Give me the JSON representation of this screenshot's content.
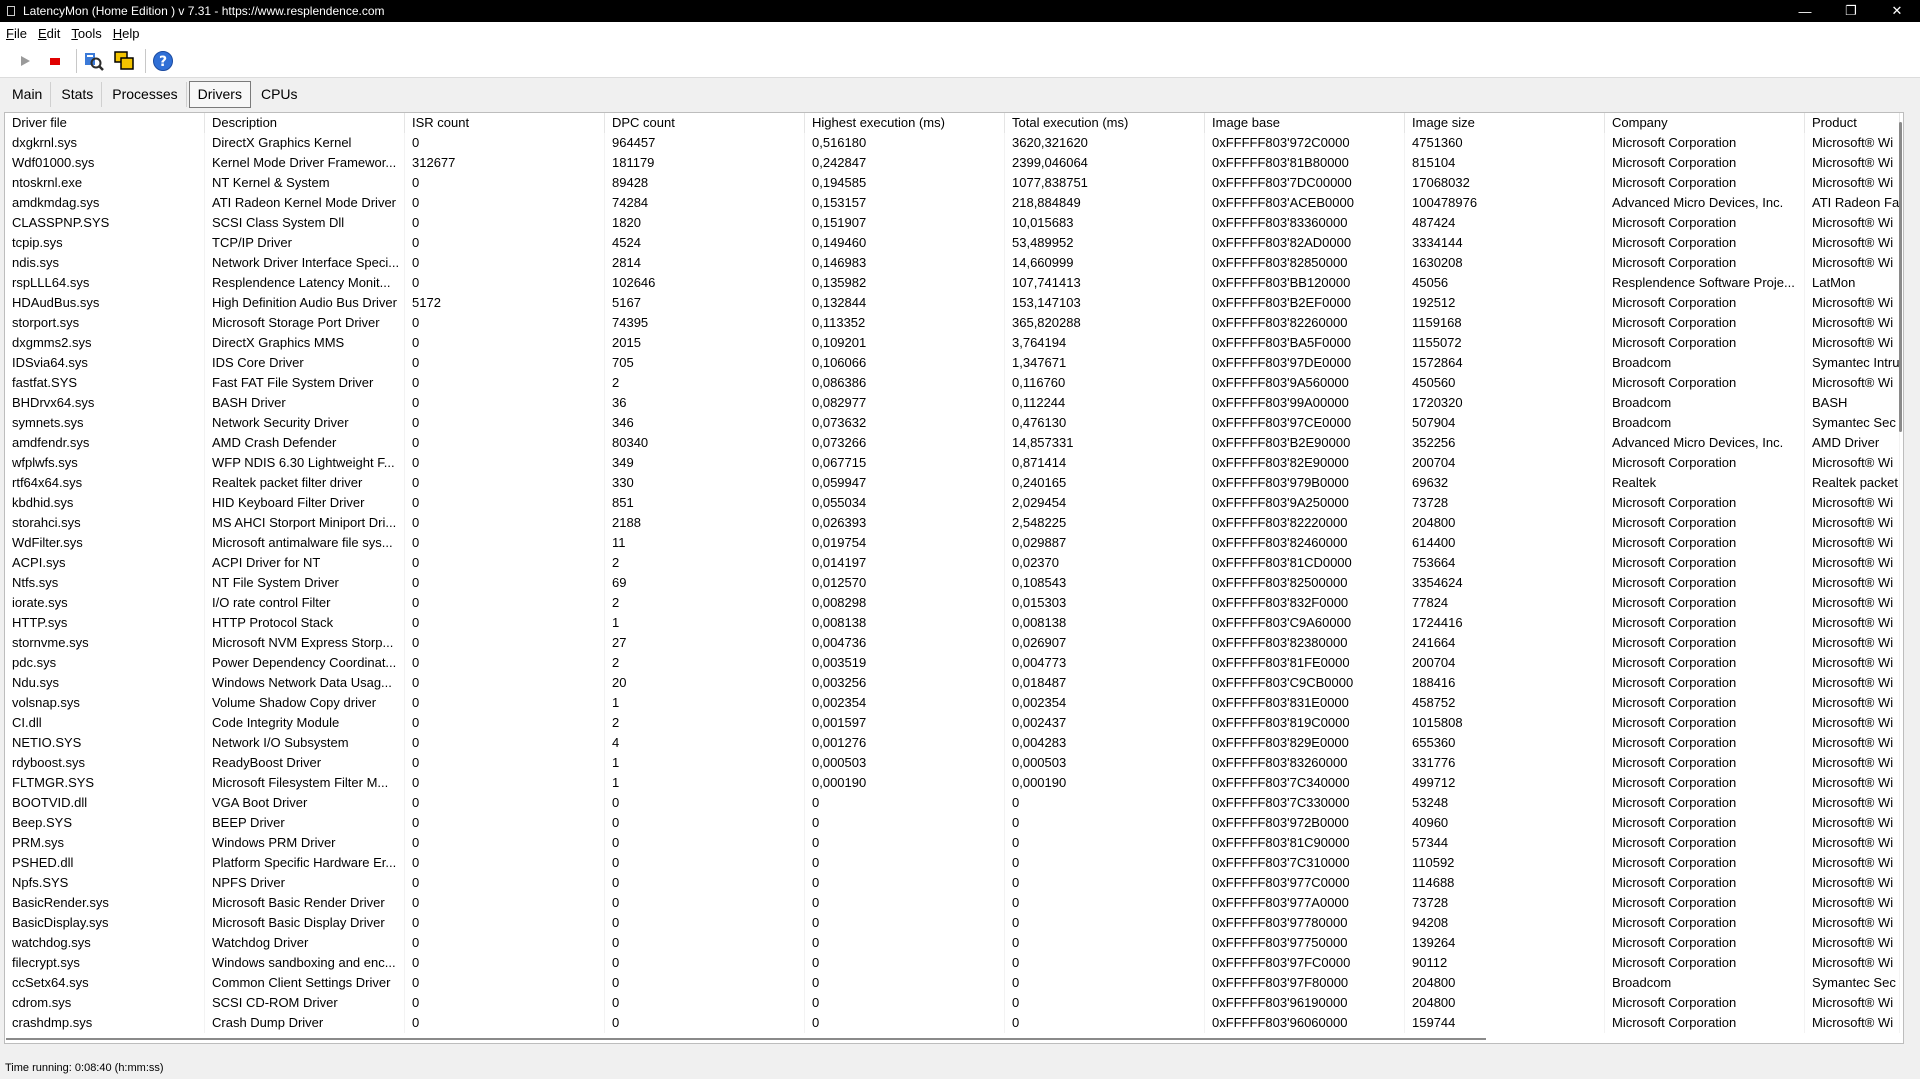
{
  "window": {
    "title": "LatencyMon  (Home Edition )  v 7.31  -  https://www.resplendence.com",
    "minimize_glyph": "—",
    "restore_glyph": "❐",
    "close_glyph": "✕"
  },
  "menu": [
    "File",
    "Edit",
    "Tools",
    "Help"
  ],
  "toolbar": {
    "icons": [
      "play-icon",
      "stop-icon",
      "search-drivers-icon",
      "windows-icon",
      "help-icon"
    ]
  },
  "tabs": [
    {
      "label": "Main",
      "active": false
    },
    {
      "label": "Stats",
      "active": false
    },
    {
      "label": "Processes",
      "active": false
    },
    {
      "label": "Drivers",
      "active": true
    },
    {
      "label": "CPUs",
      "active": false
    }
  ],
  "table": {
    "columns": [
      "Driver file",
      "Description",
      "ISR count",
      "DPC count",
      "Highest execution (ms)",
      "Total execution (ms)",
      "Image base",
      "Image size",
      "Company",
      "Product"
    ],
    "rows": [
      [
        "dxgkrnl.sys",
        "DirectX Graphics Kernel",
        "0",
        "964457",
        "0,516180",
        "3620,321620",
        "0xFFFFF803'972C0000",
        "4751360",
        "Microsoft Corporation",
        "Microsoft® Wi"
      ],
      [
        "Wdf01000.sys",
        "Kernel Mode Driver Framewor...",
        "312677",
        "181179",
        "0,242847",
        "2399,046064",
        "0xFFFFF803'81B80000",
        "815104",
        "Microsoft Corporation",
        "Microsoft® Wi"
      ],
      [
        "ntoskrnl.exe",
        "NT Kernel & System",
        "0",
        "89428",
        "0,194585",
        "1077,838751",
        "0xFFFFF803'7DC00000",
        "17068032",
        "Microsoft Corporation",
        "Microsoft® Wi"
      ],
      [
        "amdkmdag.sys",
        "ATI Radeon Kernel Mode Driver",
        "0",
        "74284",
        "0,153157",
        "218,884849",
        "0xFFFFF803'ACEB0000",
        "100478976",
        "Advanced Micro Devices, Inc.",
        "ATI Radeon Fa"
      ],
      [
        "CLASSPNP.SYS",
        "SCSI Class System Dll",
        "0",
        "1820",
        "0,151907",
        "10,015683",
        "0xFFFFF803'83360000",
        "487424",
        "Microsoft Corporation",
        "Microsoft® Wi"
      ],
      [
        "tcpip.sys",
        "TCP/IP Driver",
        "0",
        "4524",
        "0,149460",
        "53,489952",
        "0xFFFFF803'82AD0000",
        "3334144",
        "Microsoft Corporation",
        "Microsoft® Wi"
      ],
      [
        "ndis.sys",
        "Network Driver Interface Speci...",
        "0",
        "2814",
        "0,146983",
        "14,660999",
        "0xFFFFF803'82850000",
        "1630208",
        "Microsoft Corporation",
        "Microsoft® Wi"
      ],
      [
        "rspLLL64.sys",
        "Resplendence Latency Monit...",
        "0",
        "102646",
        "0,135982",
        "107,741413",
        "0xFFFFF803'BB120000",
        "45056",
        "Resplendence Software Proje...",
        "LatMon"
      ],
      [
        "HDAudBus.sys",
        "High Definition Audio Bus Driver",
        "5172",
        "5167",
        "0,132844",
        "153,147103",
        "0xFFFFF803'B2EF0000",
        "192512",
        "Microsoft Corporation",
        "Microsoft® Wi"
      ],
      [
        "storport.sys",
        "Microsoft Storage Port Driver",
        "0",
        "74395",
        "0,113352",
        "365,820288",
        "0xFFFFF803'82260000",
        "1159168",
        "Microsoft Corporation",
        "Microsoft® Wi"
      ],
      [
        "dxgmms2.sys",
        "DirectX Graphics MMS",
        "0",
        "2015",
        "0,109201",
        "3,764194",
        "0xFFFFF803'BA5F0000",
        "1155072",
        "Microsoft Corporation",
        "Microsoft® Wi"
      ],
      [
        "IDSvia64.sys",
        "IDS Core Driver",
        "0",
        "705",
        "0,106066",
        "1,347671",
        "0xFFFFF803'97DE0000",
        "1572864",
        "Broadcom",
        "Symantec Intru"
      ],
      [
        "fastfat.SYS",
        "Fast FAT File System Driver",
        "0",
        "2",
        "0,086386",
        "0,116760",
        "0xFFFFF803'9A560000",
        "450560",
        "Microsoft Corporation",
        "Microsoft® Wi"
      ],
      [
        "BHDrvx64.sys",
        "BASH Driver",
        "0",
        "36",
        "0,082977",
        "0,112244",
        "0xFFFFF803'99A00000",
        "1720320",
        "Broadcom",
        "BASH"
      ],
      [
        "symnets.sys",
        "Network Security Driver",
        "0",
        "346",
        "0,073632",
        "0,476130",
        "0xFFFFF803'97CE0000",
        "507904",
        "Broadcom",
        "Symantec Sec"
      ],
      [
        "amdfendr.sys",
        "AMD Crash Defender",
        "0",
        "80340",
        "0,073266",
        "14,857331",
        "0xFFFFF803'B2E90000",
        "352256",
        "Advanced Micro Devices, Inc.",
        "AMD Driver"
      ],
      [
        "wfplwfs.sys",
        "WFP NDIS 6.30 Lightweight F...",
        "0",
        "349",
        "0,067715",
        "0,871414",
        "0xFFFFF803'82E90000",
        "200704",
        "Microsoft Corporation",
        "Microsoft® Wi"
      ],
      [
        "rtf64x64.sys",
        "Realtek packet filter driver",
        "0",
        "330",
        "0,059947",
        "0,240165",
        "0xFFFFF803'979B0000",
        "69632",
        "Realtek",
        "Realtek packet"
      ],
      [
        "kbdhid.sys",
        "HID Keyboard Filter Driver",
        "0",
        "851",
        "0,055034",
        "2,029454",
        "0xFFFFF803'9A250000",
        "73728",
        "Microsoft Corporation",
        "Microsoft® Wi"
      ],
      [
        "storahci.sys",
        "MS AHCI Storport Miniport Dri...",
        "0",
        "2188",
        "0,026393",
        "2,548225",
        "0xFFFFF803'82220000",
        "204800",
        "Microsoft Corporation",
        "Microsoft® Wi"
      ],
      [
        "WdFilter.sys",
        "Microsoft antimalware file sys...",
        "0",
        "11",
        "0,019754",
        "0,029887",
        "0xFFFFF803'82460000",
        "614400",
        "Microsoft Corporation",
        "Microsoft® Wi"
      ],
      [
        "ACPI.sys",
        "ACPI Driver for NT",
        "0",
        "2",
        "0,014197",
        "0,02370",
        "0xFFFFF803'81CD0000",
        "753664",
        "Microsoft Corporation",
        "Microsoft® Wi"
      ],
      [
        "Ntfs.sys",
        "NT File System Driver",
        "0",
        "69",
        "0,012570",
        "0,108543",
        "0xFFFFF803'82500000",
        "3354624",
        "Microsoft Corporation",
        "Microsoft® Wi"
      ],
      [
        "iorate.sys",
        "I/O rate control Filter",
        "0",
        "2",
        "0,008298",
        "0,015303",
        "0xFFFFF803'832F0000",
        "77824",
        "Microsoft Corporation",
        "Microsoft® Wi"
      ],
      [
        "HTTP.sys",
        "HTTP Protocol Stack",
        "0",
        "1",
        "0,008138",
        "0,008138",
        "0xFFFFF803'C9A60000",
        "1724416",
        "Microsoft Corporation",
        "Microsoft® Wi"
      ],
      [
        "stornvme.sys",
        "Microsoft NVM Express Storp...",
        "0",
        "27",
        "0,004736",
        "0,026907",
        "0xFFFFF803'82380000",
        "241664",
        "Microsoft Corporation",
        "Microsoft® Wi"
      ],
      [
        "pdc.sys",
        "Power Dependency Coordinat...",
        "0",
        "2",
        "0,003519",
        "0,004773",
        "0xFFFFF803'81FE0000",
        "200704",
        "Microsoft Corporation",
        "Microsoft® Wi"
      ],
      [
        "Ndu.sys",
        "Windows Network Data Usag...",
        "0",
        "20",
        "0,003256",
        "0,018487",
        "0xFFFFF803'C9CB0000",
        "188416",
        "Microsoft Corporation",
        "Microsoft® Wi"
      ],
      [
        "volsnap.sys",
        "Volume Shadow Copy driver",
        "0",
        "1",
        "0,002354",
        "0,002354",
        "0xFFFFF803'831E0000",
        "458752",
        "Microsoft Corporation",
        "Microsoft® Wi"
      ],
      [
        "CI.dll",
        "Code Integrity Module",
        "0",
        "2",
        "0,001597",
        "0,002437",
        "0xFFFFF803'819C0000",
        "1015808",
        "Microsoft Corporation",
        "Microsoft® Wi"
      ],
      [
        "NETIO.SYS",
        "Network I/O Subsystem",
        "0",
        "4",
        "0,001276",
        "0,004283",
        "0xFFFFF803'829E0000",
        "655360",
        "Microsoft Corporation",
        "Microsoft® Wi"
      ],
      [
        "rdyboost.sys",
        "ReadyBoost Driver",
        "0",
        "1",
        "0,000503",
        "0,000503",
        "0xFFFFF803'83260000",
        "331776",
        "Microsoft Corporation",
        "Microsoft® Wi"
      ],
      [
        "FLTMGR.SYS",
        "Microsoft Filesystem Filter M...",
        "0",
        "1",
        "0,000190",
        "0,000190",
        "0xFFFFF803'7C340000",
        "499712",
        "Microsoft Corporation",
        "Microsoft® Wi"
      ],
      [
        "BOOTVID.dll",
        "VGA Boot Driver",
        "0",
        "0",
        "0",
        "0",
        "0xFFFFF803'7C330000",
        "53248",
        "Microsoft Corporation",
        "Microsoft® Wi"
      ],
      [
        "Beep.SYS",
        "BEEP Driver",
        "0",
        "0",
        "0",
        "0",
        "0xFFFFF803'972B0000",
        "40960",
        "Microsoft Corporation",
        "Microsoft® Wi"
      ],
      [
        "PRM.sys",
        "Windows PRM Driver",
        "0",
        "0",
        "0",
        "0",
        "0xFFFFF803'81C90000",
        "57344",
        "Microsoft Corporation",
        "Microsoft® Wi"
      ],
      [
        "PSHED.dll",
        "Platform Specific Hardware Er...",
        "0",
        "0",
        "0",
        "0",
        "0xFFFFF803'7C310000",
        "110592",
        "Microsoft Corporation",
        "Microsoft® Wi"
      ],
      [
        "Npfs.SYS",
        "NPFS Driver",
        "0",
        "0",
        "0",
        "0",
        "0xFFFFF803'977C0000",
        "114688",
        "Microsoft Corporation",
        "Microsoft® Wi"
      ],
      [
        "BasicRender.sys",
        "Microsoft Basic Render Driver",
        "0",
        "0",
        "0",
        "0",
        "0xFFFFF803'977A0000",
        "73728",
        "Microsoft Corporation",
        "Microsoft® Wi"
      ],
      [
        "BasicDisplay.sys",
        "Microsoft Basic Display Driver",
        "0",
        "0",
        "0",
        "0",
        "0xFFFFF803'97780000",
        "94208",
        "Microsoft Corporation",
        "Microsoft® Wi"
      ],
      [
        "watchdog.sys",
        "Watchdog Driver",
        "0",
        "0",
        "0",
        "0",
        "0xFFFFF803'97750000",
        "139264",
        "Microsoft Corporation",
        "Microsoft® Wi"
      ],
      [
        "filecrypt.sys",
        "Windows sandboxing and enc...",
        "0",
        "0",
        "0",
        "0",
        "0xFFFFF803'97FC0000",
        "90112",
        "Microsoft Corporation",
        "Microsoft® Wi"
      ],
      [
        "ccSetx64.sys",
        "Common Client Settings Driver",
        "0",
        "0",
        "0",
        "0",
        "0xFFFFF803'97F80000",
        "204800",
        "Broadcom",
        "Symantec Sec"
      ],
      [
        "cdrom.sys",
        "SCSI CD-ROM Driver",
        "0",
        "0",
        "0",
        "0",
        "0xFFFFF803'96190000",
        "204800",
        "Microsoft Corporation",
        "Microsoft® Wi"
      ],
      [
        "crashdmp.sys",
        "Crash Dump Driver",
        "0",
        "0",
        "0",
        "0",
        "0xFFFFF803'96060000",
        "159744",
        "Microsoft Corporation",
        "Microsoft® Wi"
      ]
    ]
  },
  "status": {
    "text": "Time running: 0:08:40  (h:mm:ss)"
  }
}
